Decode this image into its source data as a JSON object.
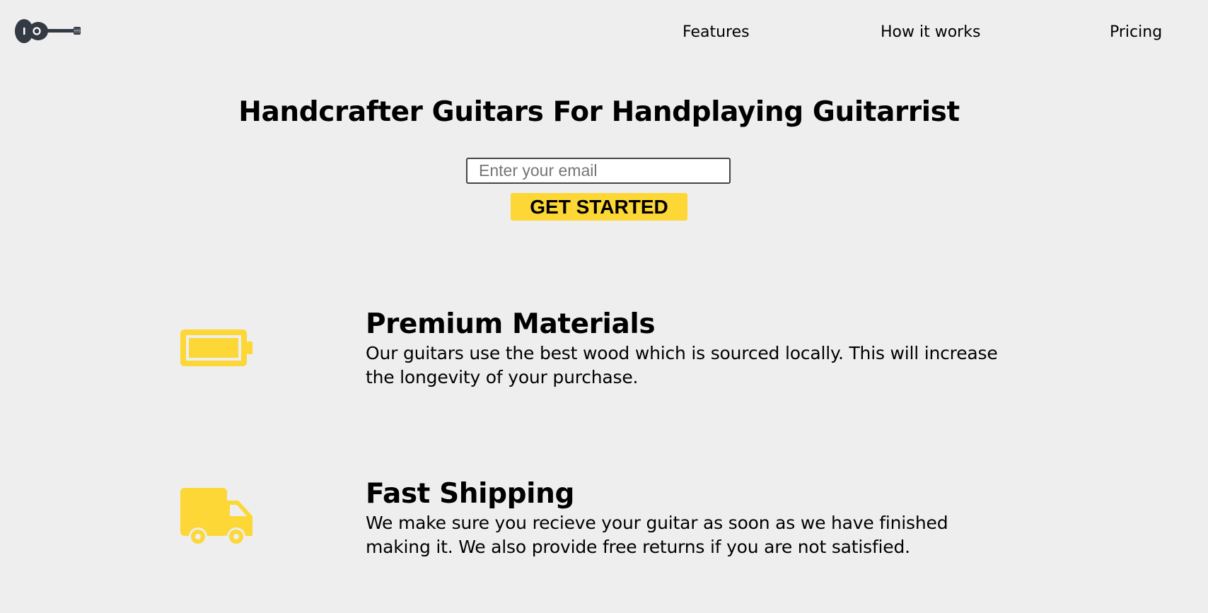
{
  "header": {
    "logo_icon": "guitar-icon",
    "nav": [
      {
        "label": "Features"
      },
      {
        "label": "How it works"
      },
      {
        "label": "Pricing"
      }
    ]
  },
  "hero": {
    "title": "Handcrafter Guitars For Handplaying Guitarrist",
    "email_placeholder": "Enter your email",
    "email_value": "",
    "cta_label": "GET STARTED"
  },
  "features": [
    {
      "icon": "battery-icon",
      "title": "Premium Materials",
      "description": "Our guitars use the best wood which is sourced locally. This will increase the longevity of your purchase."
    },
    {
      "icon": "truck-icon",
      "title": "Fast Shipping",
      "description": "We make sure you recieve your guitar as soon as we have finished making it. We also provide free returns if you are not satisfied."
    }
  ],
  "colors": {
    "background": "#eeeeee",
    "accent": "#fcd735",
    "logo": "#333a44",
    "text": "#000000"
  }
}
